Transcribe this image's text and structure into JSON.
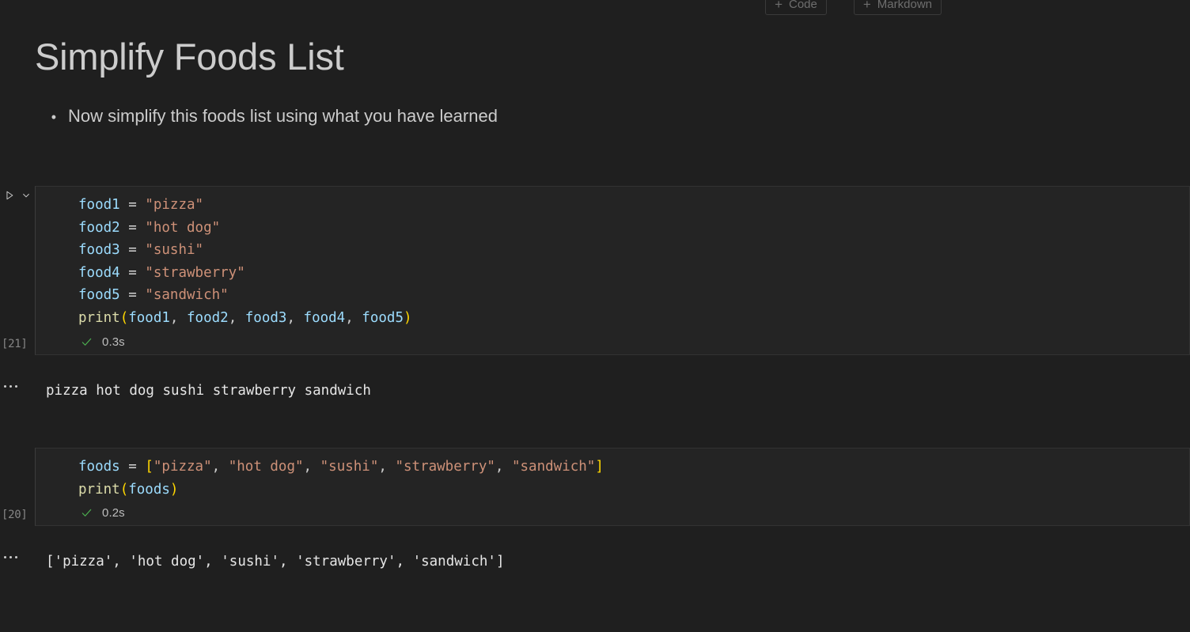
{
  "toolbar": {
    "add_code_label": "Code",
    "add_markdown_label": "Markdown",
    "plus_glyph": "+"
  },
  "markdown_cell": {
    "title": "Simplify Foods List",
    "bullet_glyph": "•",
    "bullet_text": "Now simplify this foods list using what you have learned"
  },
  "cells": [
    {
      "execution_count": "[21]",
      "elapsed": "0.3s",
      "status_icon": "check-success",
      "run_icon": "run-play-icon",
      "chevron_icon": "chevron-down-icon",
      "code_lines": [
        {
          "tokens": [
            {
              "t": "food1",
              "c": "tok-var"
            },
            {
              "t": " ",
              "c": "tok-op"
            },
            {
              "t": "=",
              "c": "tok-op"
            },
            {
              "t": " ",
              "c": "tok-op"
            },
            {
              "t": "\"pizza\"",
              "c": "tok-str"
            }
          ]
        },
        {
          "tokens": [
            {
              "t": "food2",
              "c": "tok-var"
            },
            {
              "t": " ",
              "c": "tok-op"
            },
            {
              "t": "=",
              "c": "tok-op"
            },
            {
              "t": " ",
              "c": "tok-op"
            },
            {
              "t": "\"hot dog\"",
              "c": "tok-str"
            }
          ]
        },
        {
          "tokens": [
            {
              "t": "food3",
              "c": "tok-var"
            },
            {
              "t": " ",
              "c": "tok-op"
            },
            {
              "t": "=",
              "c": "tok-op"
            },
            {
              "t": " ",
              "c": "tok-op"
            },
            {
              "t": "\"sushi\"",
              "c": "tok-str"
            }
          ]
        },
        {
          "tokens": [
            {
              "t": "food4",
              "c": "tok-var"
            },
            {
              "t": " ",
              "c": "tok-op"
            },
            {
              "t": "=",
              "c": "tok-op"
            },
            {
              "t": " ",
              "c": "tok-op"
            },
            {
              "t": "\"strawberry\"",
              "c": "tok-str"
            }
          ]
        },
        {
          "tokens": [
            {
              "t": "food5",
              "c": "tok-var"
            },
            {
              "t": " ",
              "c": "tok-op"
            },
            {
              "t": "=",
              "c": "tok-op"
            },
            {
              "t": " ",
              "c": "tok-op"
            },
            {
              "t": "\"sandwich\"",
              "c": "tok-str"
            }
          ]
        },
        {
          "tokens": [
            {
              "t": "print",
              "c": "tok-fn"
            },
            {
              "t": "(",
              "c": "tok-paren"
            },
            {
              "t": "food1",
              "c": "tok-var"
            },
            {
              "t": ", ",
              "c": "tok-punct"
            },
            {
              "t": "food2",
              "c": "tok-var"
            },
            {
              "t": ", ",
              "c": "tok-punct"
            },
            {
              "t": "food3",
              "c": "tok-var"
            },
            {
              "t": ", ",
              "c": "tok-punct"
            },
            {
              "t": "food4",
              "c": "tok-var"
            },
            {
              "t": ", ",
              "c": "tok-punct"
            },
            {
              "t": "food5",
              "c": "tok-var"
            },
            {
              "t": ")",
              "c": "tok-paren"
            }
          ]
        }
      ],
      "output": "pizza hot dog sushi strawberry sandwich"
    },
    {
      "execution_count": "[20]",
      "elapsed": "0.2s",
      "status_icon": "check-success",
      "run_icon": "run-play-icon",
      "chevron_icon": "chevron-down-icon",
      "code_lines": [
        {
          "tokens": [
            {
              "t": "foods",
              "c": "tok-var"
            },
            {
              "t": " ",
              "c": "tok-op"
            },
            {
              "t": "=",
              "c": "tok-op"
            },
            {
              "t": " ",
              "c": "tok-op"
            },
            {
              "t": "[",
              "c": "tok-brkt"
            },
            {
              "t": "\"pizza\"",
              "c": "tok-str"
            },
            {
              "t": ", ",
              "c": "tok-punct"
            },
            {
              "t": "\"hot dog\"",
              "c": "tok-str"
            },
            {
              "t": ", ",
              "c": "tok-punct"
            },
            {
              "t": "\"sushi\"",
              "c": "tok-str"
            },
            {
              "t": ", ",
              "c": "tok-punct"
            },
            {
              "t": "\"strawberry\"",
              "c": "tok-str"
            },
            {
              "t": ", ",
              "c": "tok-punct"
            },
            {
              "t": "\"sandwich\"",
              "c": "tok-str"
            },
            {
              "t": "]",
              "c": "tok-brkt"
            }
          ]
        },
        {
          "tokens": [
            {
              "t": "print",
              "c": "tok-fn"
            },
            {
              "t": "(",
              "c": "tok-paren"
            },
            {
              "t": "foods",
              "c": "tok-var"
            },
            {
              "t": ")",
              "c": "tok-paren"
            }
          ]
        }
      ],
      "output": "['pizza', 'hot dog', 'sushi', 'strawberry', 'sandwich']"
    }
  ],
  "colors": {
    "background": "#1f1f1f",
    "cell_background": "#242424",
    "cell_border": "#323232",
    "text": "#cccccc",
    "variable": "#9cdcfe",
    "string": "#ce9178",
    "function": "#dcdcaa",
    "bracket": "#ffd700",
    "success": "#4caf50",
    "muted": "#868686"
  }
}
